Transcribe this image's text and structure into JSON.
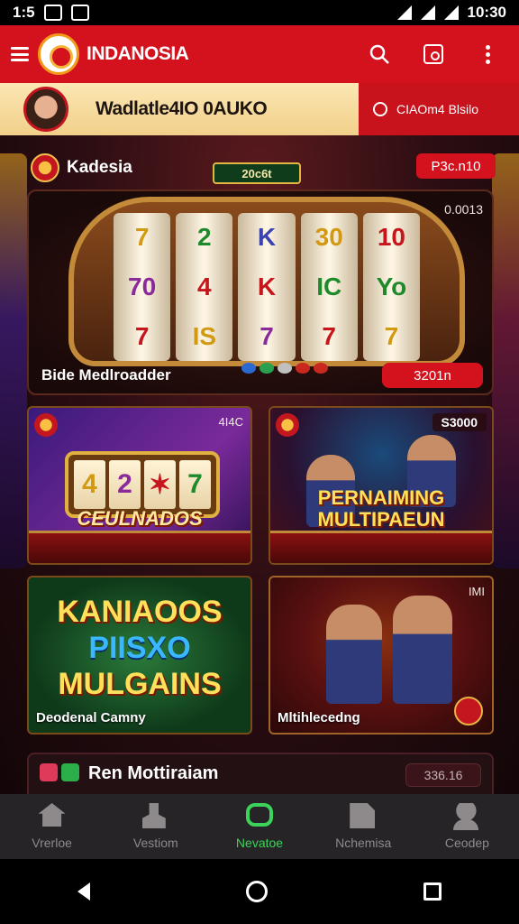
{
  "status_bar": {
    "time_left": "1:5",
    "time_right": "10:30"
  },
  "header": {
    "title": "INDANOSIA"
  },
  "banner": {
    "text": "Wadlatle4IO 0AUKO",
    "right_text": "CIAOm4 Blsilo"
  },
  "section": {
    "title": "Kadesia",
    "pill_green": "20c6t",
    "pill_red": "P3c.n10"
  },
  "featured": {
    "value": "0.0013",
    "label": "Bide Medlroadder",
    "button": "3201n",
    "reels": [
      [
        "7",
        "70",
        "7"
      ],
      [
        "2",
        "4",
        "IS"
      ],
      [
        "K",
        "K",
        "7"
      ],
      [
        "30",
        "IC",
        "7"
      ],
      [
        "10",
        "Yo",
        "7"
      ]
    ]
  },
  "games": [
    {
      "corner": "4I4C",
      "title": "CEULNADOS",
      "reels": [
        "4",
        "2",
        "✶",
        "7"
      ]
    },
    {
      "badge": "S3000",
      "title_line1": "PERNAIMING",
      "title_line2": "MULTIPAEUN"
    },
    {
      "title_line1": "KANIAOOS",
      "title_line2": "PIISXO",
      "title_line3": "MULGAINS",
      "label": "Deodenal Camny"
    },
    {
      "corner": "IMI",
      "label": "Mltihlecedng"
    }
  ],
  "list_item": {
    "title": "Ren Mottiraiam",
    "value": "336.16"
  },
  "nav": [
    {
      "label": "Vrerloe",
      "icon": "home-icon"
    },
    {
      "label": "Vestiom",
      "icon": "person-icon"
    },
    {
      "label": "Nevatoe",
      "icon": "game-icon"
    },
    {
      "label": "Nchemisa",
      "icon": "edit-icon"
    },
    {
      "label": "Ceodep",
      "icon": "user-icon"
    }
  ],
  "colors": {
    "header": "#d3121e",
    "active_nav": "#3bd35a",
    "banner": "#fbe7b3"
  }
}
